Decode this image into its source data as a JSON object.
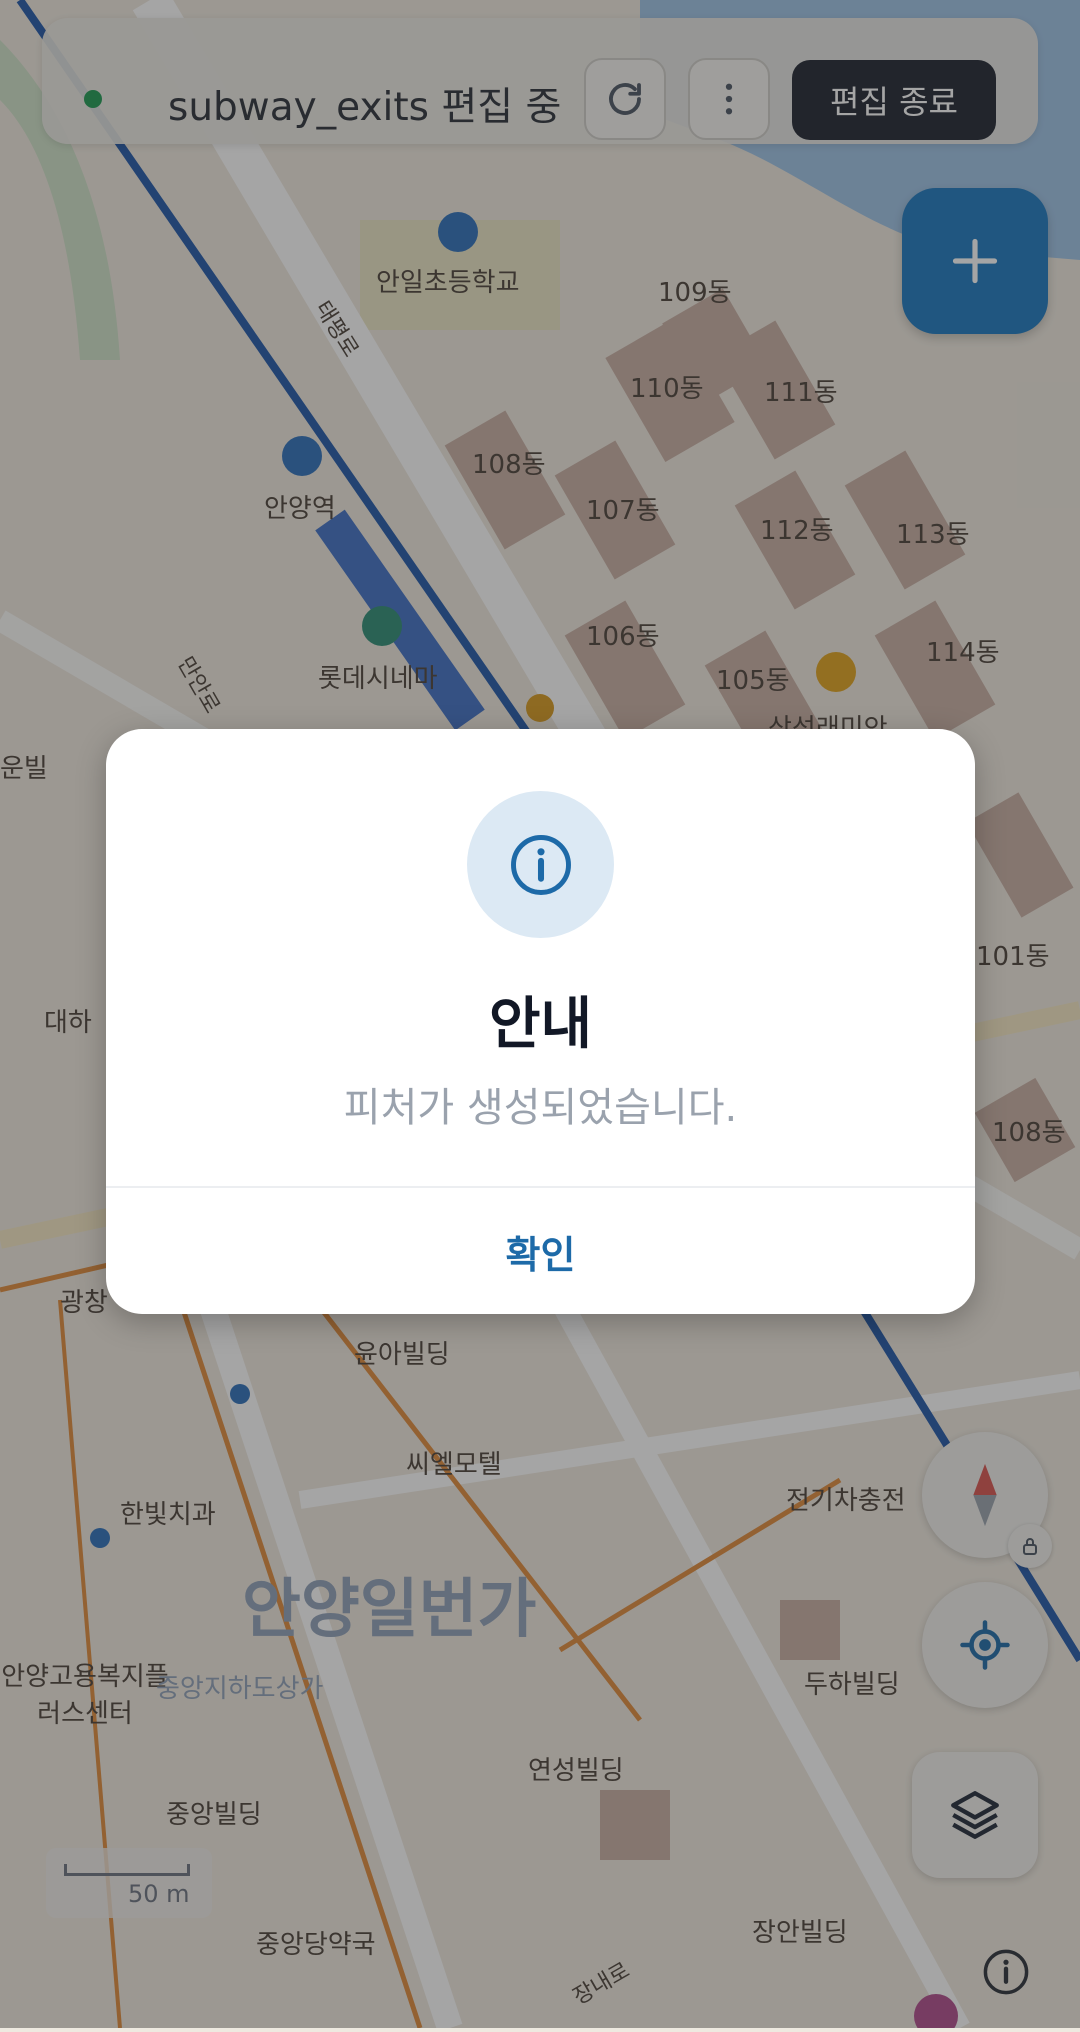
{
  "topbar": {
    "title": "subway_exits 편집 중",
    "status_color": "#1c9a52",
    "refresh_icon": "refresh-icon",
    "more_icon": "more-vertical-icon",
    "end_edit_label": "편집 종료"
  },
  "fab": {
    "icon": "plus-icon",
    "color": "#1a78bf"
  },
  "map": {
    "labels": [
      "안일초등학교",
      "109동",
      "110동",
      "111동",
      "108동",
      "107동",
      "112동",
      "113동",
      "안양역",
      "106동",
      "105동",
      "114동",
      "롯데시네마",
      "삼성래미안",
      "101동",
      "108동",
      "대하",
      "운빌",
      "광창",
      "윤아빌딩",
      "씨엘모텔",
      "전기차충전",
      "한빛치과",
      "안양일번가",
      "안양고용복지플러스센터",
      "중앙지하도상가",
      "두하빌딩",
      "연성빌딩",
      "중앙빌딩",
      "중앙당약국",
      "장안빌딩",
      "만안로",
      "장내로",
      "태평로"
    ]
  },
  "scale": {
    "label": "50 m"
  },
  "controls": {
    "compass_icon": "compass-icon",
    "lock_icon": "lock-icon",
    "locate_icon": "locate-icon",
    "layers_icon": "layers-icon",
    "info_icon": "info-icon"
  },
  "dialog": {
    "icon": "info-icon",
    "title": "안내",
    "message": "피처가 생성되었습니다.",
    "confirm_label": "확인"
  }
}
